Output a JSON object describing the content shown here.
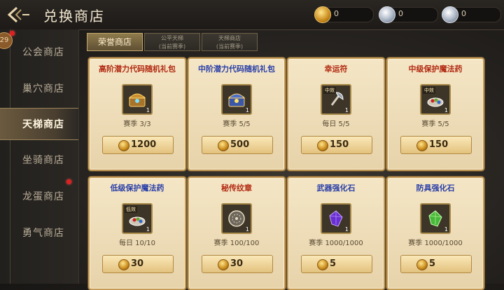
{
  "header": {
    "title": "兑换商店"
  },
  "currencies": [
    {
      "icon": "honor-coin-icon",
      "value": "0"
    },
    {
      "icon": "silver-coin-icon",
      "value": "0"
    },
    {
      "icon": "silver-coin-icon",
      "value": "0"
    }
  ],
  "sidebar": {
    "level": "29",
    "items": [
      {
        "label": "公会商店",
        "active": false
      },
      {
        "label": "巢穴商店",
        "active": false
      },
      {
        "label": "天梯商店",
        "active": true
      },
      {
        "label": "坐骑商店",
        "active": false
      },
      {
        "label": "龙蛋商店",
        "active": false
      },
      {
        "label": "勇气商店",
        "active": false
      }
    ]
  },
  "tabs": [
    {
      "line1": "荣誉商店",
      "line2": "",
      "active": true
    },
    {
      "line1": "公平天梯",
      "line2": "(当前赛季)",
      "active": false
    },
    {
      "line1": "天梯商店",
      "line2": "(当前赛季)",
      "active": false
    }
  ],
  "items": [
    {
      "name": "高阶潜力代码随机礼包",
      "limit": "赛季  3/3",
      "price": "1200",
      "icon": "treasure-chest-icon",
      "qty": "1",
      "grade": ""
    },
    {
      "name": "中阶潜力代码随机礼包",
      "limit": "赛季  5/5",
      "price": "500",
      "icon": "treasure-chest-icon",
      "qty": "1",
      "grade": ""
    },
    {
      "name": "幸运符",
      "limit": "每日  5/5",
      "price": "150",
      "icon": "axe-charm-icon",
      "qty": "1",
      "grade": "中效"
    },
    {
      "name": "中级保护魔法药",
      "limit": "赛季  5/5",
      "price": "150",
      "icon": "potion-plate-icon",
      "qty": "1",
      "grade": "中效"
    },
    {
      "name": "低级保护魔法药",
      "limit": "每日  10/10",
      "price": "30",
      "icon": "potion-plate-icon",
      "qty": "1",
      "grade": "低效"
    },
    {
      "name": "秘传纹章",
      "limit": "赛季  100/100",
      "price": "30",
      "icon": "emblem-icon",
      "qty": "1",
      "grade": ""
    },
    {
      "name": "武器强化石",
      "limit": "赛季  1000/1000",
      "price": "5",
      "icon": "purple-crystal-icon",
      "qty": "1",
      "grade": ""
    },
    {
      "name": "防具强化石",
      "limit": "赛季  1000/1000",
      "price": "5",
      "icon": "green-crystal-icon",
      "qty": "1",
      "grade": ""
    }
  ],
  "colors": {
    "accent": "#c49a55",
    "name_blue": "#2a3fa8",
    "name_red": "#b22a12",
    "badge_red": "#e02020"
  }
}
